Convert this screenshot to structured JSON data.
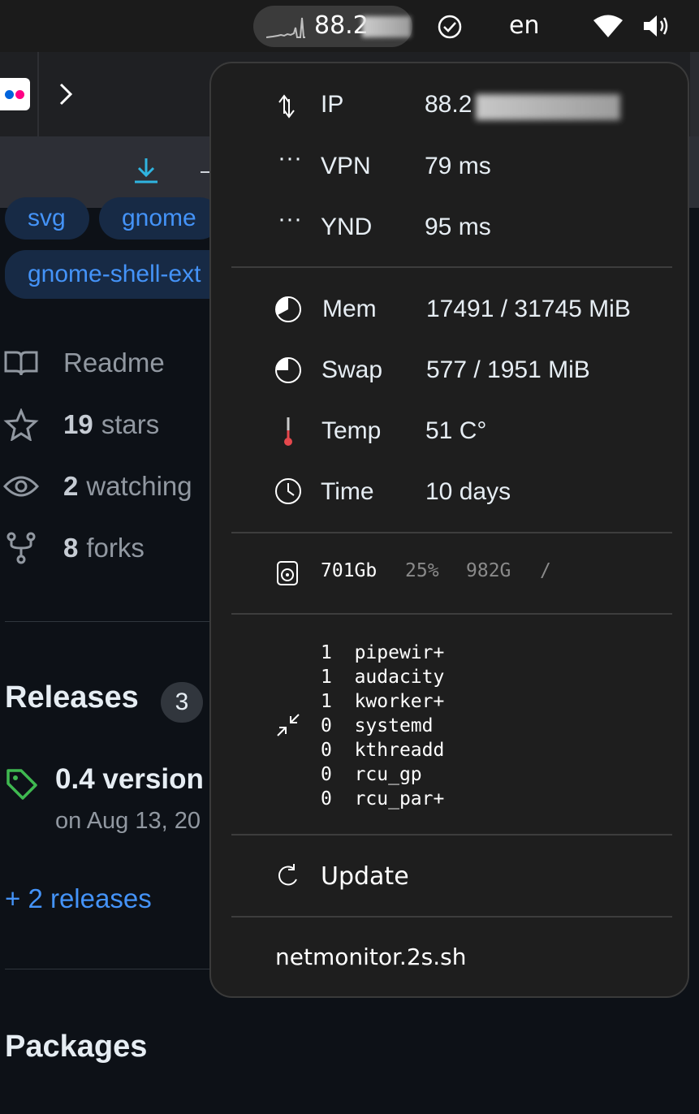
{
  "topbar": {
    "net_label": "88.2",
    "language": "en"
  },
  "background": {
    "tags": [
      "svg",
      "gnome",
      "gnome-shell-ext"
    ],
    "readme": "Readme",
    "stars_count": "19",
    "stars_label": "stars",
    "watching_count": "2",
    "watching_label": "watching",
    "forks_count": "8",
    "forks_label": "forks",
    "releases_title": "Releases",
    "releases_count": "3",
    "release_name": "0.4 version",
    "release_date": "on Aug 13, 20",
    "more_releases": "+ 2 releases",
    "packages_title": "Packages"
  },
  "popup": {
    "network": [
      {
        "label": "IP",
        "value": "88.2"
      },
      {
        "label": "VPN",
        "value": "79 ms"
      },
      {
        "label": "YND",
        "value": "95 ms"
      }
    ],
    "system": [
      {
        "label": "Mem",
        "value": "17491 / 31745 MiB"
      },
      {
        "label": "Swap",
        "value": "577 / 1951 MiB"
      },
      {
        "label": "Temp",
        "value": "51 C°"
      },
      {
        "label": "Time",
        "value": "10 days"
      }
    ],
    "disk": {
      "used": "701Gb",
      "percent": "25%",
      "size": "982G",
      "mount": "/"
    },
    "processes": [
      {
        "count": "1",
        "name": "pipewir+"
      },
      {
        "count": "1",
        "name": "audacity"
      },
      {
        "count": "1",
        "name": "kworker+"
      },
      {
        "count": "0",
        "name": "systemd"
      },
      {
        "count": "0",
        "name": "kthreadd"
      },
      {
        "count": "0",
        "name": "rcu_gp"
      },
      {
        "count": "0",
        "name": "rcu_par+"
      }
    ],
    "update_label": "Update",
    "script_name": "netmonitor.2s.sh"
  },
  "colors": {
    "panel": "#1b1b1b",
    "popup_bg": "#1e1e1e",
    "link": "#4493f8",
    "thermo": "#e5484d",
    "download_accent": "#2fb4e0"
  },
  "icons": [
    "updown-arrows-icon",
    "dots-icon",
    "pie-icon",
    "thermometer-icon",
    "clock-icon",
    "disk-icon",
    "shrink-icon",
    "refresh-icon",
    "check-circle-icon",
    "wifi-icon",
    "volume-icon"
  ]
}
